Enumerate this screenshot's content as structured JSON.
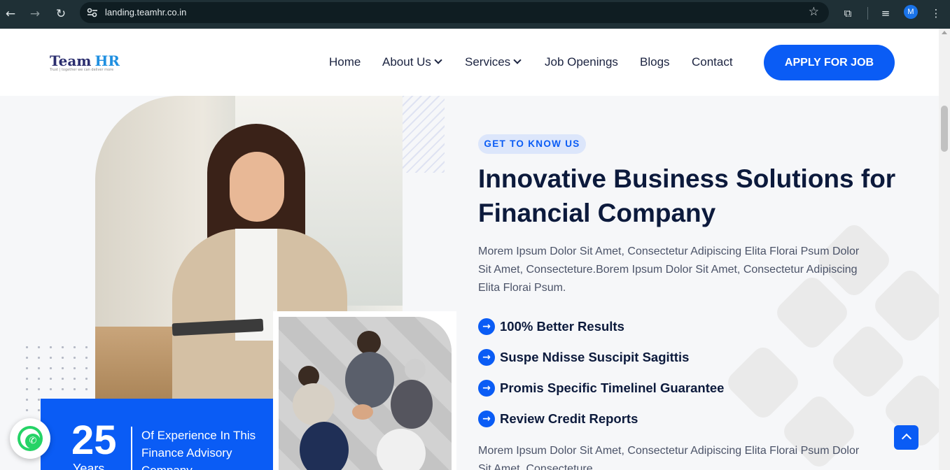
{
  "browser": {
    "url": "landing.teamhr.co.in",
    "profile_initial": "M"
  },
  "header": {
    "logo_team": "Team",
    "logo_hr": "HR",
    "logo_tagline": "Trust | together we can deliver more",
    "nav": {
      "home": "Home",
      "about": "About Us",
      "services": "Services",
      "jobs": "Job Openings",
      "blogs": "Blogs",
      "contact": "Contact"
    },
    "apply_label": "APPLY FOR JOB"
  },
  "about": {
    "badge": "GET TO KNOW US",
    "title": "Innovative Business Solutions for Financial Company",
    "description": "Morem Ipsum Dolor Sit Amet, Consectetur Adipiscing Elita Florai Psum Dolor Sit Amet, Consecteture.Borem Ipsum Dolor Sit Amet, Consectetur Adipiscing Elita Florai Psum.",
    "features": [
      "100% Better Results",
      "Suspe Ndisse Suscipit Sagittis",
      "Promis Specific Timelinel Guarantee",
      "Review Credit Reports"
    ],
    "description2": "Morem Ipsum Dolor Sit Amet, Consectetur Adipiscing Elita Florai Psum Dolor Sit Amet, Consecteture."
  },
  "experience": {
    "number": "25",
    "unit": "Years",
    "text": "Of Experience In This Finance Advisory Company"
  },
  "colors": {
    "accent": "#0a5cf5",
    "heading": "#0c1a3c",
    "whatsapp": "#25d366"
  }
}
